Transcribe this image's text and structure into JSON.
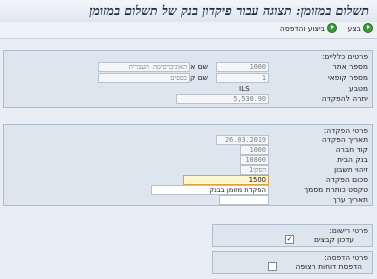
{
  "window": {
    "title": "תשלום במזומן: תצוגה עבור פיקדון בנק של תשלום במזומן"
  },
  "toolbar": {
    "execute_label": "בצע",
    "execute_print_label": "ביצוע והדפסה"
  },
  "general": {
    "title": "פרטים כלליים:",
    "site_label": "מספר אתר",
    "site_value": "1000",
    "site_name_label": "שם אתר",
    "site_name_value": "האוניברסיטה העברית",
    "cashbox_label": "מספר קופאי",
    "cashbox_value": "1",
    "cashbox_name_label": "שם קופאי",
    "cashbox_name_value": "כספים",
    "currency_label": "מטבע",
    "currency_value": "ILS",
    "balance_label": "יתרה להפקדה",
    "balance_value": "5,530.90"
  },
  "deposit": {
    "title": "פרטי הפקדה:",
    "date_label": "תאריך הפקדה",
    "date_value": "26.03.2019",
    "company_label": "קוד חברה",
    "company_value": "1000",
    "bank_label": "בנק הבית",
    "bank_value": "10800",
    "account_label": "זיהוי חשבון",
    "account_value": "הפקו1",
    "amount_label": "סכום הפקדה",
    "amount_value": "1500",
    "text_label": "טקסט כותרת מסמך",
    "text_value": "הפקדת מזומן בבנק",
    "value_date_label": "תאריך ערך",
    "value_date_value": ""
  },
  "posting": {
    "title": "פרטי רישום:",
    "update_label": "עדכון קבצים",
    "update_checked": "✓"
  },
  "printing": {
    "title": "פרטי הדפסה:",
    "print_label": "הדפסת דוחות רצופה",
    "print_checked": ""
  },
  "colors": {
    "accent_title": "#1d2e44",
    "panel_bg": "#dde6ef",
    "active_field": "#fff8cf",
    "execute_icon": "#3e9a3a"
  }
}
